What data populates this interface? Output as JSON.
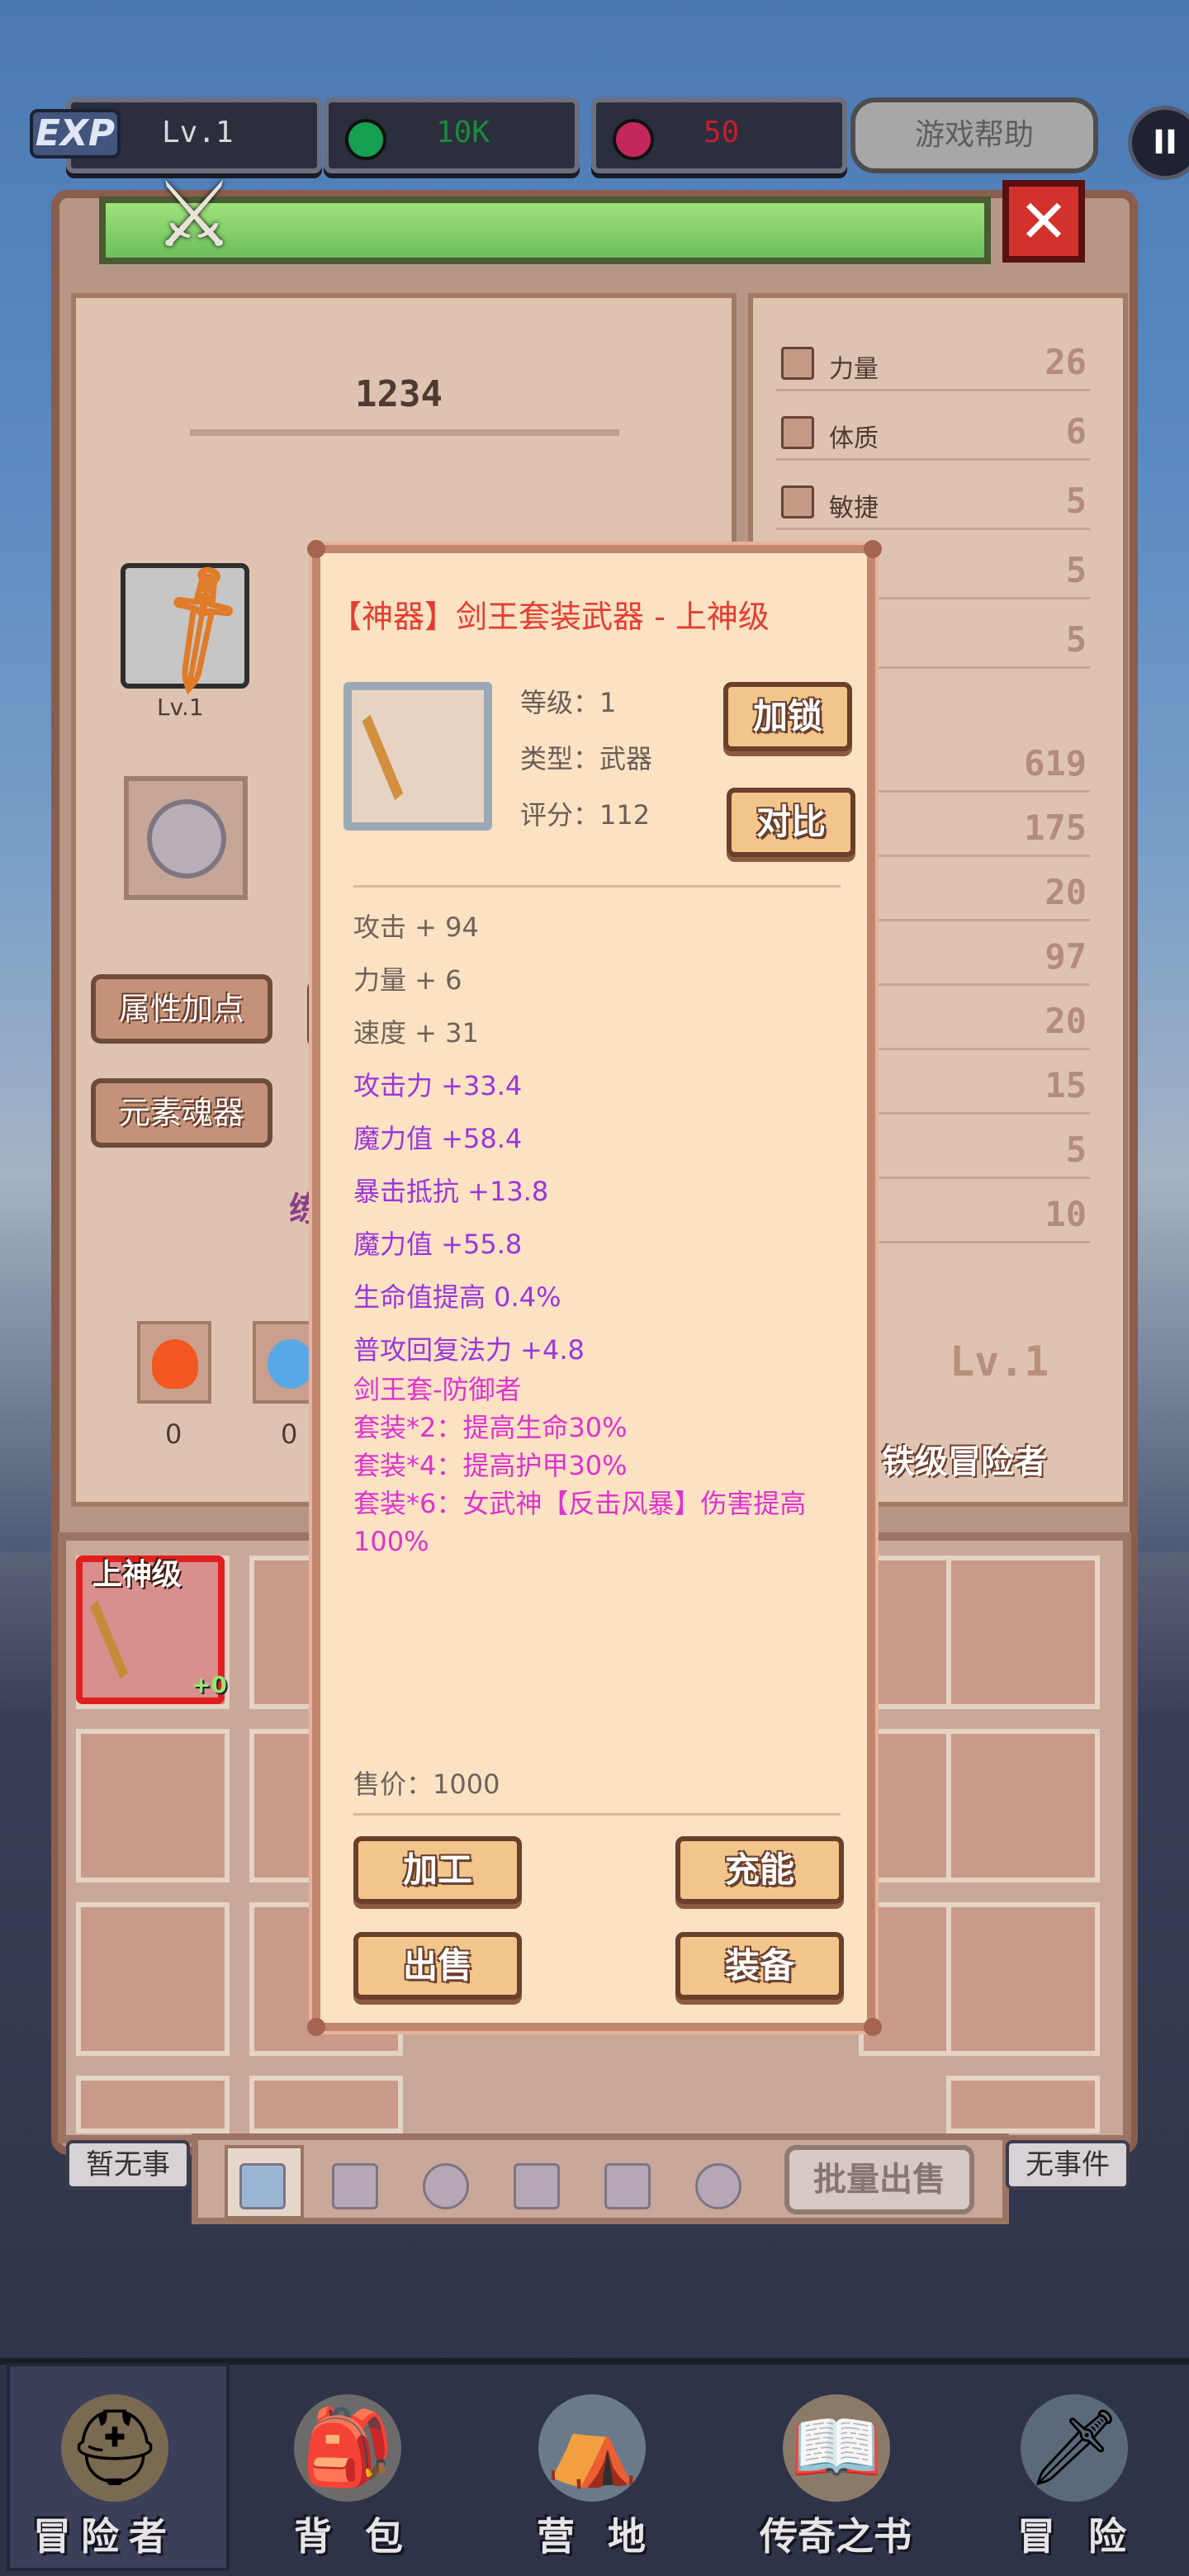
{
  "topbar": {
    "exp_badge": "EXP",
    "level": "Lv.1",
    "gold": "10K",
    "gems": "50",
    "help_label": "游戏帮助",
    "pause_glyph": "II"
  },
  "character": {
    "name": "1234",
    "avatar_level": "Lv.1",
    "buttons": [
      "属性加点",
      "元素魂器"
    ],
    "purple_peek": "练",
    "element_counts": [
      "0",
      "0"
    ],
    "right_level": "Lv.1",
    "rank_label": "铁级冒险者"
  },
  "stats_top": [
    {
      "label": "力量",
      "value": "26"
    },
    {
      "label": "体质",
      "value": "6"
    },
    {
      "label": "敏捷",
      "value": "5"
    },
    {
      "label": "",
      "value": "5"
    },
    {
      "label": "",
      "value": "5"
    }
  ],
  "stats_bottom": [
    {
      "value": "619"
    },
    {
      "value": "175"
    },
    {
      "value": "20"
    },
    {
      "value": "97"
    },
    {
      "value": "20"
    },
    {
      "value": "15"
    },
    {
      "value": "5"
    },
    {
      "value": "10"
    }
  ],
  "inventory": {
    "first_item_grade": "上神级",
    "first_item_plus": "+0",
    "bulk_sell": "批量出售",
    "no_event_left": "暂无事",
    "no_event_right": "无事件"
  },
  "popup": {
    "title": "【神器】剑王套装武器 - 上神级",
    "level": "等级：1",
    "type": "类型：武器",
    "score": "评分：112",
    "lock_btn": "加锁",
    "compare_btn": "对比",
    "base_attrs": [
      "攻击 + 94",
      "力量 + 6",
      "速度 + 31"
    ],
    "bonus_attrs": [
      "攻击力 +33.4",
      "魔力值 +58.4",
      "暴击抵抗 +13.8",
      "魔力值 +55.8",
      "生命值提高 0.4%",
      "普攻回复法力 +4.8"
    ],
    "set_lines": [
      "剑王套-防御者",
      "套装*2：提高生命30%",
      "套装*4：提高护甲30%",
      "套装*6：女武神【反击风暴】伤害提高100%"
    ],
    "price": "售价：1000",
    "btn_process": "加工",
    "btn_charge": "充能",
    "btn_sell": "出售",
    "btn_equip": "装备"
  },
  "nav": [
    "冒险者",
    "背包",
    "营地",
    "传奇之书",
    "冒险"
  ],
  "colors": {
    "title_red": "#e33e34",
    "bonus_purple": "#9a36dc",
    "set_magenta": "#de32d0",
    "gold_green": "#1d8a3a",
    "gem_red": "#c81d2d"
  },
  "icons": {
    "gold": "green-gem-icon",
    "gems": "red-gem-icon",
    "weapon": "sword-icon"
  }
}
